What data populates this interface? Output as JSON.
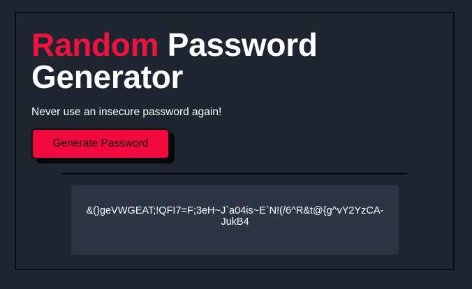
{
  "header": {
    "title_accent": "Random",
    "title_rest_line1": "Password",
    "title_line2": "Generator",
    "subtitle": "Never use an insecure password again!"
  },
  "actions": {
    "generate_label": "Generate Password"
  },
  "output": {
    "password": "&()geVWGEAT;!QFI7=F;3eH~J`a04is~E`N!(/6^R&t@{g^vY2YzCA-JukB4"
  },
  "colors": {
    "accent": "#f0123e",
    "background": "#1f2530",
    "panel": "#2c3544",
    "text": "#ffffff"
  }
}
